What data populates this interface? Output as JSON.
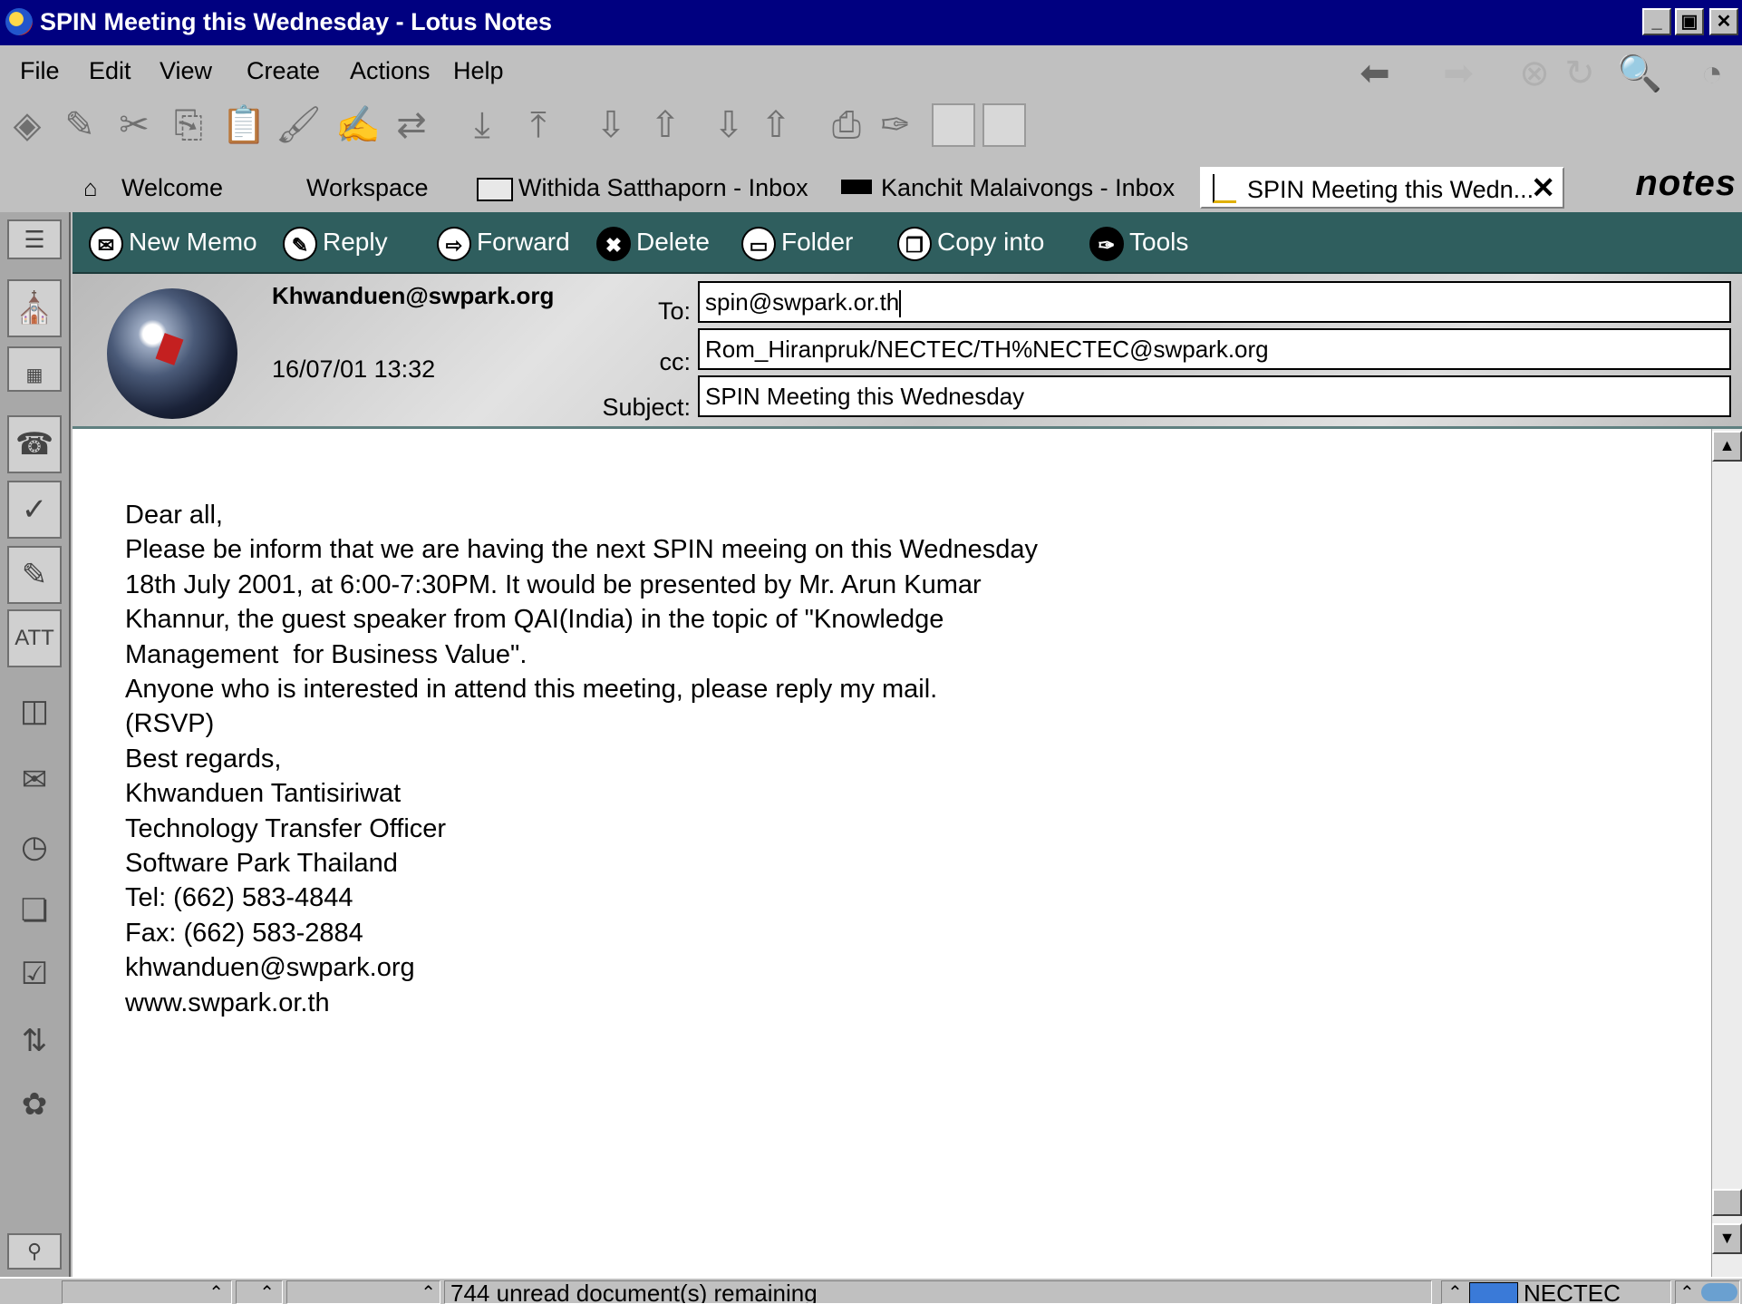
{
  "window": {
    "title": "SPIN Meeting this Wednesday - Lotus Notes",
    "min_glyph": "_",
    "max_glyph": "▣",
    "close_glyph": "✕"
  },
  "menu": {
    "file": "File",
    "edit": "Edit",
    "view": "View",
    "create": "Create",
    "actions": "Actions",
    "help": "Help"
  },
  "tabs": [
    {
      "label": "Welcome",
      "icon": "home-icon"
    },
    {
      "label": "Workspace",
      "icon": ""
    },
    {
      "label": "Withida Satthaporn - Inbox",
      "icon": "inbox-icon"
    },
    {
      "label": "Kanchit Malaivongs - Inbox",
      "icon": "inbox-icon"
    },
    {
      "label": "SPIN Meeting this Wedn...",
      "icon": "document-icon",
      "close": "✕"
    }
  ],
  "brand": "notes",
  "actions": [
    {
      "label": "New Memo",
      "glyph": "✉"
    },
    {
      "label": "Reply",
      "glyph": "✎"
    },
    {
      "label": "Forward",
      "glyph": "⇨"
    },
    {
      "label": "Delete",
      "glyph": "✖"
    },
    {
      "label": "Folder",
      "glyph": "▭"
    },
    {
      "label": "Copy into",
      "glyph": "❐"
    },
    {
      "label": "Tools",
      "glyph": "✑"
    }
  ],
  "memo": {
    "from": "Khwanduen@swpark.org",
    "date": "16/07/01 13:32",
    "to_label": "To:",
    "to": "spin@swpark.or.th",
    "cc_label": "cc:",
    "cc": "Rom_Hiranpruk/NECTEC/TH%NECTEC@swpark.org",
    "subject_label": "Subject:",
    "subject": "SPIN Meeting this Wednesday"
  },
  "body_lines": [
    "Dear all,",
    "Please be inform that we are having the next SPIN meeing on this Wednesday",
    "18th July 2001, at 6:00-7:30PM. It would be presented by Mr. Arun Kumar",
    "Khannur, the guest speaker from QAI(India) in the topic of \"Knowledge",
    "Management  for Business Value\".",
    "Anyone who is interested in attend this meeting, please reply my mail.",
    "(RSVP)",
    "Best regards,",
    "Khwanduen Tantisiriwat",
    "Technology Transfer Officer",
    "Software Park Thailand",
    "Tel: (662) 583-4844",
    "Fax: (662) 583-2884",
    "khwanduen@swpark.org",
    "www.swpark.or.th"
  ],
  "status": {
    "message": "744 unread document(s) remaining",
    "location": "NECTEC"
  },
  "colors": {
    "titlebar": "#000080",
    "actionbar": "#2f5e5e"
  }
}
